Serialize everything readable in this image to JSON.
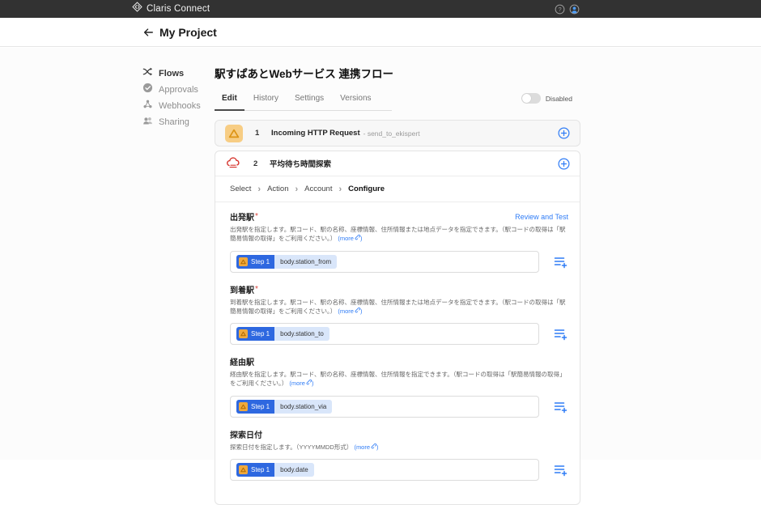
{
  "topbar": {
    "brand": "Claris Connect"
  },
  "header": {
    "title": "My Project"
  },
  "sidebar": {
    "items": [
      {
        "label": "Flows",
        "active": true
      },
      {
        "label": "Approvals",
        "active": false
      },
      {
        "label": "Webhooks",
        "active": false
      },
      {
        "label": "Sharing",
        "active": false
      }
    ]
  },
  "flow": {
    "title": "駅すぱあとWebサービス 連携フロー",
    "tabs": [
      "Edit",
      "History",
      "Settings",
      "Versions"
    ],
    "active_tab": "Edit",
    "toggle_label": "Disabled",
    "steps": [
      {
        "num": "1",
        "title": "Incoming HTTP Request",
        "subtitle": "- send_to_ekispert"
      },
      {
        "num": "2",
        "title": "平均待ち時間探索",
        "subtitle": ""
      }
    ],
    "breadcrumb": [
      "Select",
      "Action",
      "Account",
      "Configure"
    ],
    "breadcrumb_sep": "›",
    "review_link": "Review and Test",
    "more_open": "(",
    "more_label": "more",
    "more_close": ")",
    "fields": [
      {
        "label": "出発駅",
        "req": "*",
        "desc": "出発駅を指定します。駅コード、駅の名称、座標情報、住所情報または地点データを指定できます。（駅コードの取得は「駅簡易情報の取得」をご利用ください。）",
        "token": {
          "step": "Step 1",
          "value": "body.station_from"
        }
      },
      {
        "label": "到着駅",
        "req": "*",
        "desc": "到着駅を指定します。駅コード、駅の名称、座標情報、住所情報または地点データを指定できます。（駅コードの取得は「駅簡易情報の取得」をご利用ください。）",
        "token": {
          "step": "Step 1",
          "value": "body.station_to"
        }
      },
      {
        "label": "経由駅",
        "req": "",
        "desc": "経由駅を指定します。駅コード、駅の名称、座標情報、住所情報を指定できます。（駅コードの取得は「駅簡易情報の取得」をご利用ください。）",
        "token": {
          "step": "Step 1",
          "value": "body.station_via"
        }
      },
      {
        "label": "探索日付",
        "req": "",
        "desc": "探索日付を指定します。（YYYYMMDD形式）",
        "token": {
          "step": "Step 1",
          "value": "body.date"
        }
      }
    ]
  },
  "colors": {
    "topbar_bg": "#323232",
    "accent_blue": "#2f7cf6",
    "chip_blue": "#2e68e0",
    "chip_blue_light": "#d9e6fa",
    "required_red": "#d9453c",
    "http_icon_orange": "#f7cd84",
    "ekispert_red": "#d6332c"
  }
}
